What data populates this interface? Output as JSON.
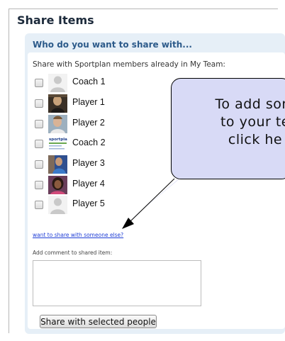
{
  "title": "Share Items",
  "panel": {
    "heading": "Who do you want to share with...",
    "subheading": "Share with Sportplan members already in My Team:"
  },
  "members": [
    {
      "name": "Coach 1",
      "avatar": "placeholder-avatar",
      "checked": false
    },
    {
      "name": "Player 1",
      "avatar": "photo-avatar",
      "checked": false
    },
    {
      "name": "Player 2",
      "avatar": "photo-avatar",
      "checked": false
    },
    {
      "name": "Coach 2",
      "avatar": "sportplan-logo-avatar",
      "checked": false
    },
    {
      "name": "Player 3",
      "avatar": "photo-avatar",
      "checked": false
    },
    {
      "name": "Player 4",
      "avatar": "photo-avatar",
      "checked": false
    },
    {
      "name": "Player 5",
      "avatar": "placeholder-avatar",
      "checked": false
    }
  ],
  "share_link": "want to share with someone else?",
  "comment": {
    "label": "Add comment to shared item:",
    "value": ""
  },
  "share_button": "Share with selected people",
  "callout": {
    "lines": [
      "To add som",
      "to your te",
      "click he"
    ]
  },
  "colors": {
    "panel_bg": "#e6eff7",
    "panel_heading": "#2c5a8a",
    "link": "#1f3ed6",
    "callout_bg": "#d8daf6"
  }
}
